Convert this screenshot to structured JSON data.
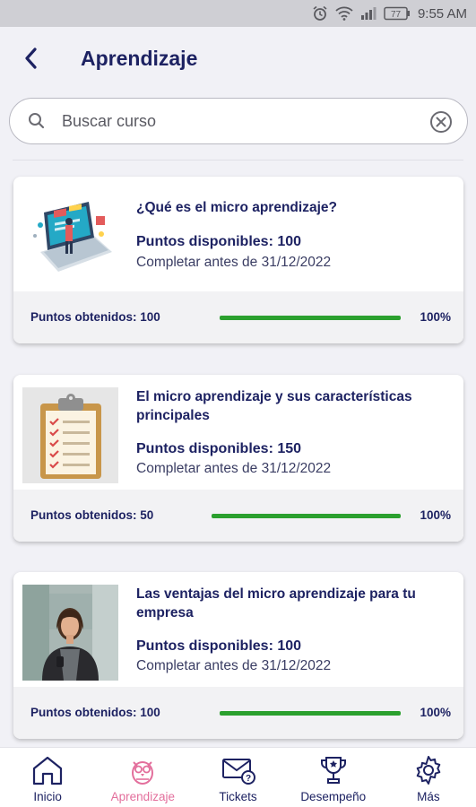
{
  "status": {
    "battery": "77",
    "time": "9:55 AM"
  },
  "header": {
    "title": "Aprendizaje"
  },
  "search": {
    "placeholder": "Buscar curso"
  },
  "courses": [
    {
      "title": "¿Qué es el micro aprendizaje?",
      "points": "Puntos disponibles: 100",
      "deadline": "Completar antes de 31/12/2022",
      "earned": "Puntos obtenidos: 100",
      "progress_label": "100%",
      "progress": 1.0,
      "thumb_icon": "laptop-dashboard-illustration"
    },
    {
      "title": "El micro aprendizaje y sus características principales",
      "points": "Puntos disponibles: 150",
      "deadline": "Completar antes de 31/12/2022",
      "earned": "Puntos obtenidos: 50",
      "progress_label": "100%",
      "progress": 1.0,
      "thumb_icon": "clipboard-checklist-illustration"
    },
    {
      "title": "Las ventajas del micro aprendizaje para tu empresa",
      "points": "Puntos disponibles: 100",
      "deadline": "Completar antes de 31/12/2022",
      "earned": "Puntos obtenidos: 100",
      "progress_label": "100%",
      "progress": 1.0,
      "thumb_icon": "businesswoman-photo"
    }
  ],
  "nav": {
    "items": [
      {
        "label": "Inicio",
        "icon": "home-icon"
      },
      {
        "label": "Aprendizaje",
        "icon": "owl-icon",
        "active": true
      },
      {
        "label": "Tickets",
        "icon": "mail-question-icon"
      },
      {
        "label": "Desempeño",
        "icon": "trophy-icon"
      },
      {
        "label": "Más",
        "icon": "gear-icon"
      }
    ]
  },
  "colors": {
    "primary": "#1d2262",
    "accent_active": "#e36f9c",
    "progress": "#2ba02e",
    "background": "#f1f1f6"
  }
}
